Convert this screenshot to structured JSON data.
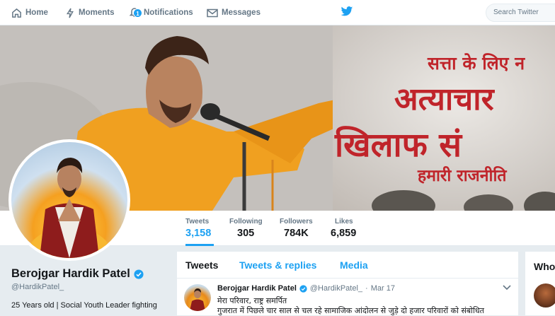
{
  "nav": {
    "home": "Home",
    "moments": "Moments",
    "notifications": "Notifications",
    "notifications_count": "1",
    "messages": "Messages",
    "search_placeholder": "Search Twitter"
  },
  "banner": {
    "line1": "सत्ता के लिए न",
    "line2": "अत्याचार",
    "line3": "खिलाफ सं",
    "line4": "हमारी राजनीति"
  },
  "stats": [
    {
      "label": "Tweets",
      "value": "3,158"
    },
    {
      "label": "Following",
      "value": "305"
    },
    {
      "label": "Followers",
      "value": "784K"
    },
    {
      "label": "Likes",
      "value": "6,859"
    }
  ],
  "profile": {
    "name": "Berojgar Hardik Patel",
    "handle": "@HardikPatel_",
    "bio": "25 Years old | Social Youth Leader fighting"
  },
  "tabs": {
    "tweets": "Tweets",
    "replies": "Tweets & replies",
    "media": "Media"
  },
  "tweet": {
    "name": "Berojgar Hardik Patel",
    "handle": "@HardikPatel_",
    "separator": "·",
    "date": "Mar 17",
    "line1": "मेरा परिवार, राष्ट्र समर्पित",
    "line2": "गुजरात में पिछले चार साल से चल रहे सामाजिक आंदोलन से जुड़े दो हजार परिवारों को संबोधित"
  },
  "who": {
    "title": "Who"
  },
  "colors": {
    "accent": "#1da1f2",
    "banner_text": "#c0242a",
    "background": "#e6ecf0"
  }
}
